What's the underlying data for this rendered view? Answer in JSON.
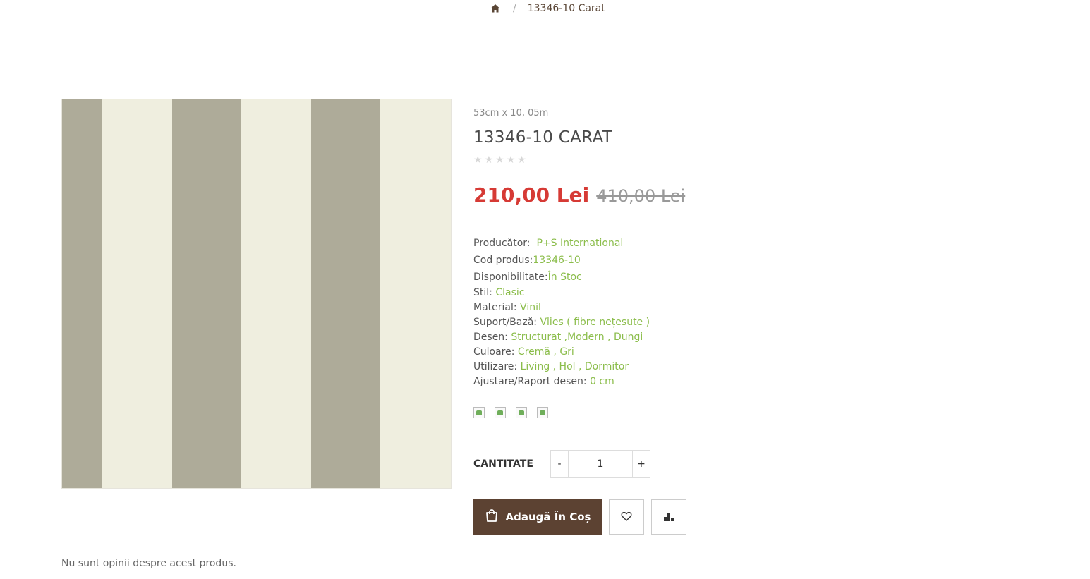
{
  "breadcrumb": {
    "home_icon": "home-icon",
    "separator": "/",
    "current": "13346-10 Carat"
  },
  "product": {
    "dimensions": "53cm x 10, 05m",
    "title": "13346-10 CARAT",
    "rating_stars": 5,
    "rating_value": 0,
    "price_new": "210,00 Lei",
    "price_old": "410,00 Lei",
    "image_colors": {
      "stripe_dark": "#aeab99",
      "stripe_light": "#efeedf"
    }
  },
  "details": [
    {
      "label": "Producător:",
      "value": "P+S International"
    },
    {
      "label": "Cod produs:",
      "value": "13346-10"
    },
    {
      "label": "Disponibilitate:",
      "value": "În Stoc"
    },
    {
      "label": "Stil:",
      "value": "Clasic"
    },
    {
      "label": "Material:",
      "value": "Vinil"
    },
    {
      "label": "Suport/Bază:",
      "value": "Vlies ( fibre nețesute )"
    },
    {
      "label": "Desen:",
      "value": "Structurat ,Modern , Dungi"
    },
    {
      "label": "Culoare:",
      "value": "Cremă , Gri"
    },
    {
      "label": "Utilizare:",
      "value": "Living , Hol , Dormitor"
    },
    {
      "label": "Ajustare/Raport desen:",
      "value": "0 cm"
    }
  ],
  "thumbs_count": 4,
  "quantity": {
    "label": "CANTITATE",
    "minus": "-",
    "plus": "+",
    "value": "1"
  },
  "actions": {
    "add_to_cart": "Adaugă În Coș",
    "cart_icon": "shopping-bag-icon",
    "wishlist_icon": "heart-icon",
    "compare_icon": "compare-icon"
  },
  "reviews": {
    "empty_text": "Nu sunt opinii despre acest produs."
  },
  "colors": {
    "accent_green": "#8bbd4b",
    "price_red": "#d63a35",
    "button_brown": "#5c4232"
  }
}
